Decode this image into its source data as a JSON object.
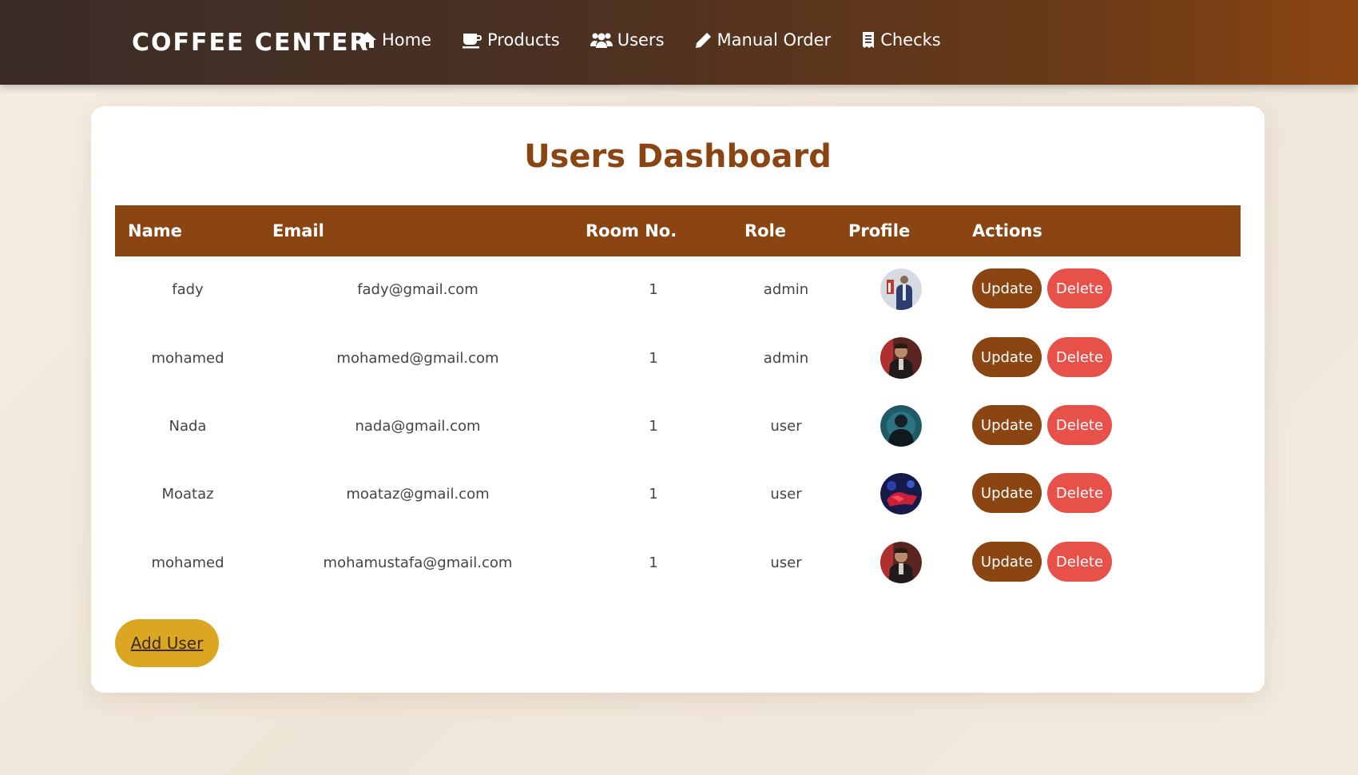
{
  "navbar": {
    "brand": "COFFEE CENTER",
    "links": [
      {
        "label": "Home",
        "icon": "home-icon"
      },
      {
        "label": "Products",
        "icon": "coffee-cup-icon"
      },
      {
        "label": "Users",
        "icon": "users-icon"
      },
      {
        "label": "Manual Order",
        "icon": "pencil-icon"
      },
      {
        "label": "Checks",
        "icon": "receipt-icon"
      }
    ]
  },
  "main": {
    "title": "Users Dashboard",
    "table": {
      "headers": [
        "Name",
        "Email",
        "Room No.",
        "Role",
        "Profile",
        "Actions"
      ],
      "rows": [
        {
          "name": "fady",
          "email": "fady@gmail.com",
          "room": "1",
          "role": "admin"
        },
        {
          "name": "mohamed",
          "email": "mohamed@gmail.com",
          "room": "1",
          "role": "admin"
        },
        {
          "name": "Nada",
          "email": "nada@gmail.com",
          "room": "1",
          "role": "user"
        },
        {
          "name": "Moataz",
          "email": "moataz@gmail.com",
          "room": "1",
          "role": "user"
        },
        {
          "name": "mohamed",
          "email": "mohamustafa@gmail.com",
          "room": "1",
          "role": "user"
        }
      ]
    },
    "actions": {
      "update_label": "Update",
      "delete_label": "Delete"
    },
    "add_user_label": "Add User"
  },
  "colors": {
    "brand": "#8b4513",
    "delete": "#e8504a",
    "add": "#dba722"
  }
}
